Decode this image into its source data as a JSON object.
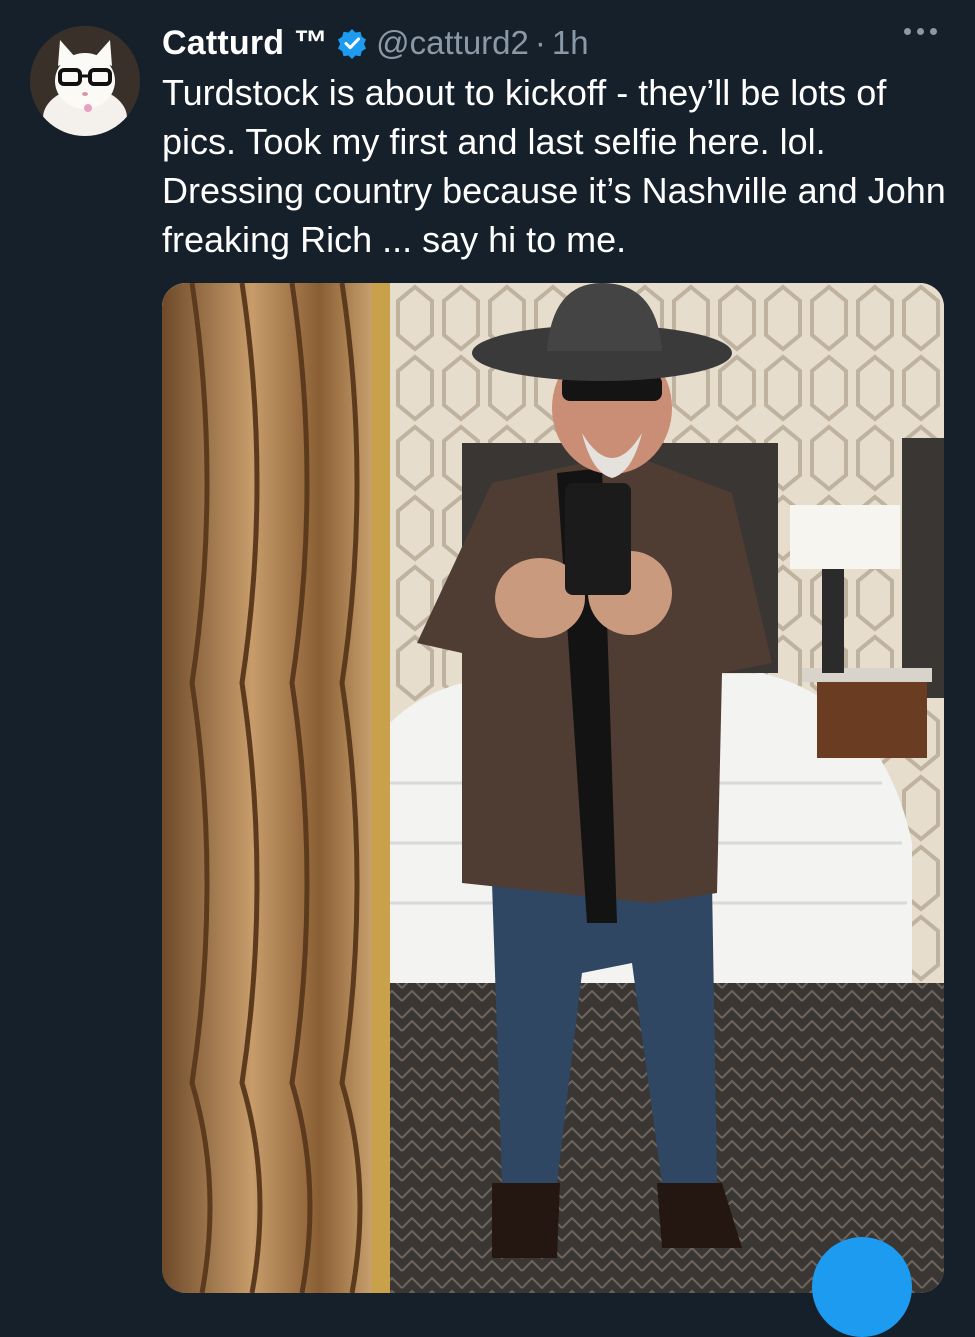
{
  "tweet": {
    "author": {
      "display_name": "Catturd ™",
      "handle": "@catturd2",
      "separator": "·",
      "time": "1h",
      "verified": true,
      "avatar_icon": "cat-with-glasses-avatar"
    },
    "text": "Turdstock is about to kickoff - they’ll be lots of pics. Took my first and last selfie here. lol. Dressing country because it’s Nashville and John freaking Rich ... say hi to me.",
    "media_icon": "mirror-selfie-photo",
    "more_icon": "more-options-icon",
    "compose_icon": "compose-fab-icon"
  },
  "colors": {
    "background": "#15202b",
    "text": "#ffffff",
    "secondary_text": "#8b98a5",
    "verified_badge": "#1d9bf0",
    "accent": "#1d9bf0"
  }
}
